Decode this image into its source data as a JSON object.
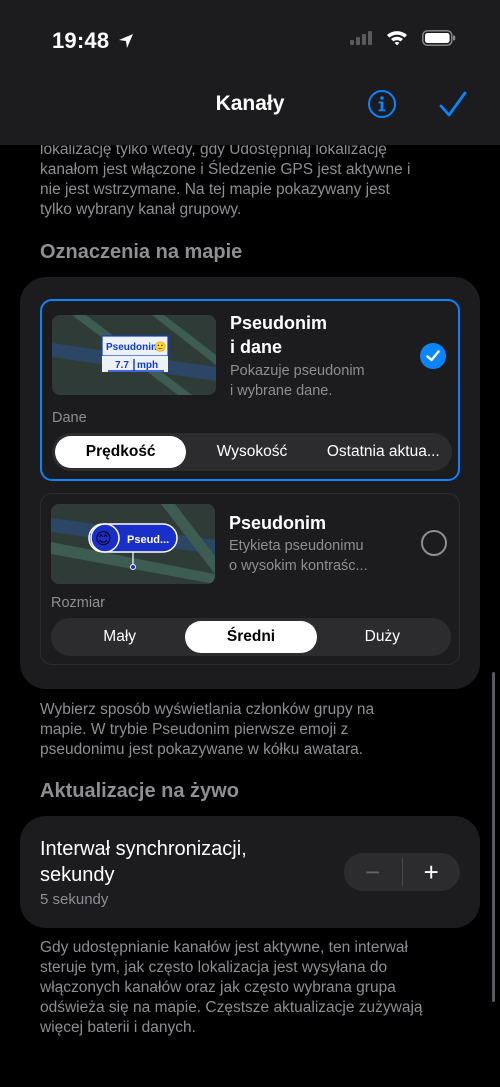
{
  "status_bar": {
    "time": "19:48"
  },
  "nav": {
    "title": "Kanały"
  },
  "intro_text_lines": [
    "lokalizację tylko wtedy, gdy Udostępniaj lokalizację",
    "kanałom jest włączone i Śledzenie GPS jest aktywne i",
    "nie jest wstrzymane. Na tej mapie pokazywany jest",
    "tylko wybrany kanał grupowy."
  ],
  "map_labels_section": {
    "header": "Oznaczenia na mapie",
    "option1": {
      "title_line1": "Pseudonim",
      "title_line2": "i dane",
      "subtitle_line1": "Pokazuje pseudonim",
      "subtitle_line2": "i wybrane dane.",
      "selected": true,
      "thumb_nick": "Pseudonim",
      "thumb_emoji": "🙂",
      "thumb_value": "7.7",
      "thumb_unit": "mph",
      "label": "Dane",
      "segments": [
        "Prędkość",
        "Wysokość",
        "Ostatnia aktua..."
      ],
      "active_segment": 0
    },
    "option2": {
      "title": "Pseudonim",
      "subtitle_line1": "Etykieta pseudonimu",
      "subtitle_line2": "o wysokim kontraśc...",
      "selected": false,
      "thumb_emoji": "😊",
      "thumb_nick": "Pseud...",
      "label": "Rozmiar",
      "segments": [
        "Mały",
        "Średni",
        "Duży"
      ],
      "active_segment": 1
    },
    "footer_lines": [
      "Wybierz sposób wyświetlania członków grupy na",
      "mapie. W trybie Pseudonim pierwsze emoji z",
      "pseudonimu jest pokazywane w kółku awatara."
    ]
  },
  "live_updates_section": {
    "header": "Aktualizacje na żywo",
    "interval_title_line1": "Interwał synchronizacji,",
    "interval_title_line2": "sekundy",
    "interval_value": "5 sekundy",
    "minus": "−",
    "plus": "+",
    "footer_lines": [
      "Gdy udostępnianie kanałów jest aktywne, ten interwał",
      "steruje tym, jak często lokalizacja jest wysyłana do",
      "włączonych kanałów oraz jak często wybrana grupa",
      "odświeża się na mapie. Częstsze aktualizacje zużywają",
      "więcej baterii i danych."
    ]
  },
  "colors": {
    "accent": "#0a84ff",
    "background": "#000000",
    "card": "#1c1c1e",
    "secondary_text": "#8e8e93"
  }
}
